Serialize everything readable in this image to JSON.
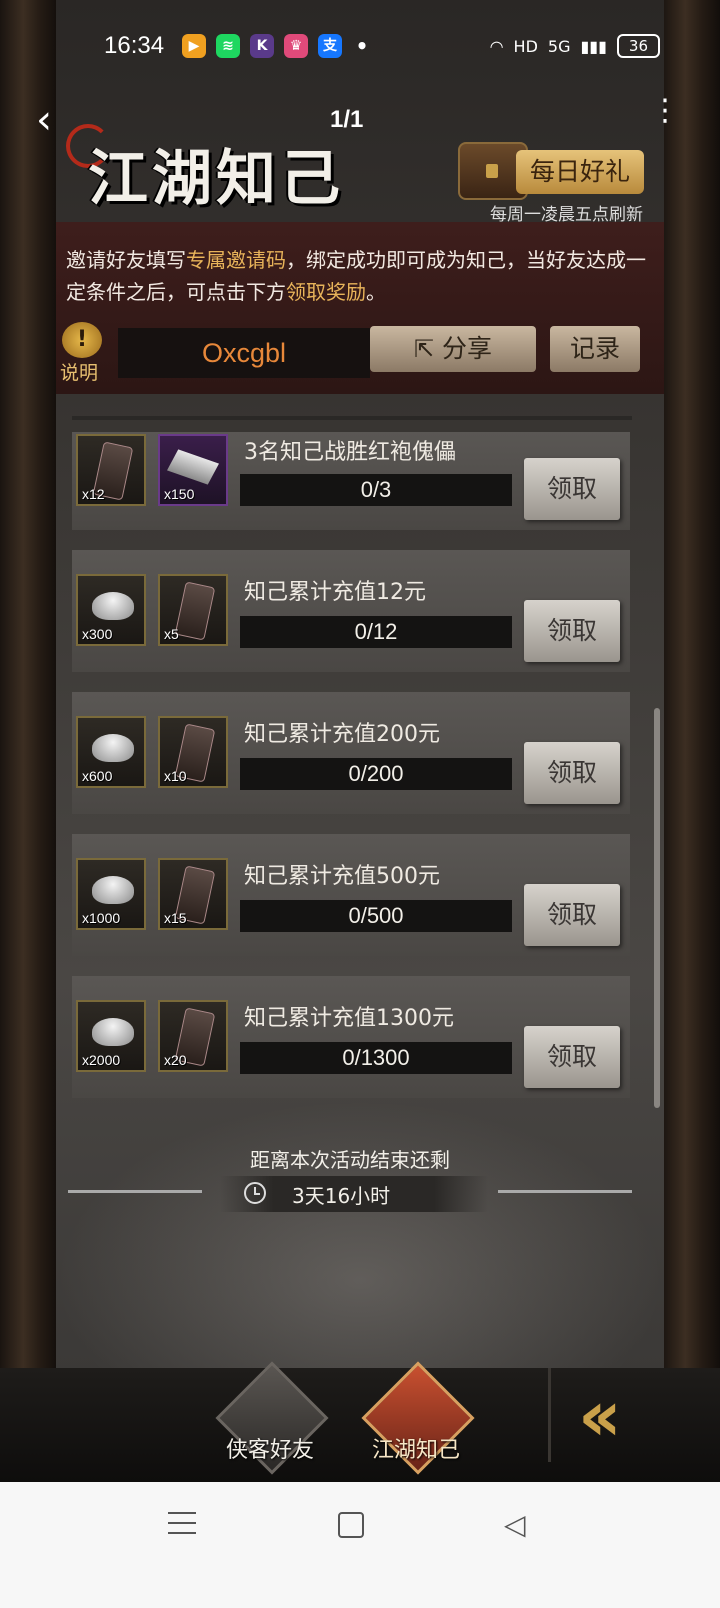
{
  "status_bar": {
    "time": "16:34",
    "apps": [
      {
        "icon": "video-app-icon",
        "label": "▶",
        "color": "#f0a020"
      },
      {
        "icon": "spotify-icon",
        "label": "≋",
        "color": "#1ed760"
      },
      {
        "icon": "k-app-icon",
        "label": "K",
        "color": "#5a3a8a"
      },
      {
        "icon": "crown-app-icon",
        "label": "♛",
        "color": "#e04a7a"
      },
      {
        "icon": "alipay-icon",
        "label": "支",
        "color": "#1677ff"
      }
    ],
    "dot": "•",
    "hd": "HD",
    "network": "5G",
    "battery": "36"
  },
  "header": {
    "page_indicator": "1/1",
    "title": "江湖知己",
    "daily_gift_label": "每日好礼",
    "refresh_note": "每周一凌晨五点刷新"
  },
  "invite": {
    "desc_part1": "邀请好友填写",
    "desc_hl1": "专属邀请码",
    "desc_part2": "，绑定成功即可成为知己，当好友达成一定条件之后，可点击下方",
    "desc_hl2": "领取奖励",
    "desc_part3": "。",
    "help_label": "说明",
    "help_icon": "!",
    "code": "Oxcgbl",
    "share_label": "分享",
    "records_label": "记录"
  },
  "tasks": [
    {
      "title": "3名知己战胜红袍傀儡",
      "progress": "0/3",
      "progress_value": 0,
      "rewards": [
        {
          "type": "token",
          "qty": "x12"
        },
        {
          "type": "bar",
          "qty": "x150"
        }
      ],
      "claim_label": "领取"
    },
    {
      "title": "知己累计充值12元",
      "progress": "0/12",
      "progress_value": 0,
      "rewards": [
        {
          "type": "ingot",
          "qty": "x300"
        },
        {
          "type": "token",
          "qty": "x5"
        }
      ],
      "claim_label": "领取"
    },
    {
      "title": "知己累计充值200元",
      "progress": "0/200",
      "progress_value": 0,
      "rewards": [
        {
          "type": "ingot",
          "qty": "x600"
        },
        {
          "type": "token",
          "qty": "x10"
        }
      ],
      "claim_label": "领取"
    },
    {
      "title": "知己累计充值500元",
      "progress": "0/500",
      "progress_value": 0,
      "rewards": [
        {
          "type": "ingot",
          "qty": "x1000"
        },
        {
          "type": "token",
          "qty": "x15"
        }
      ],
      "claim_label": "领取"
    },
    {
      "title": "知己累计充值1300元",
      "progress": "0/1300",
      "progress_value": 0,
      "rewards": [
        {
          "type": "ingot",
          "qty": "x2000"
        },
        {
          "type": "token",
          "qty": "x20"
        }
      ],
      "claim_label": "领取"
    }
  ],
  "timer": {
    "label": "距离本次活动结束还剩",
    "value": "3天16小时"
  },
  "tabs": [
    {
      "label": "侠客好友"
    },
    {
      "label": "江湖知己"
    }
  ]
}
